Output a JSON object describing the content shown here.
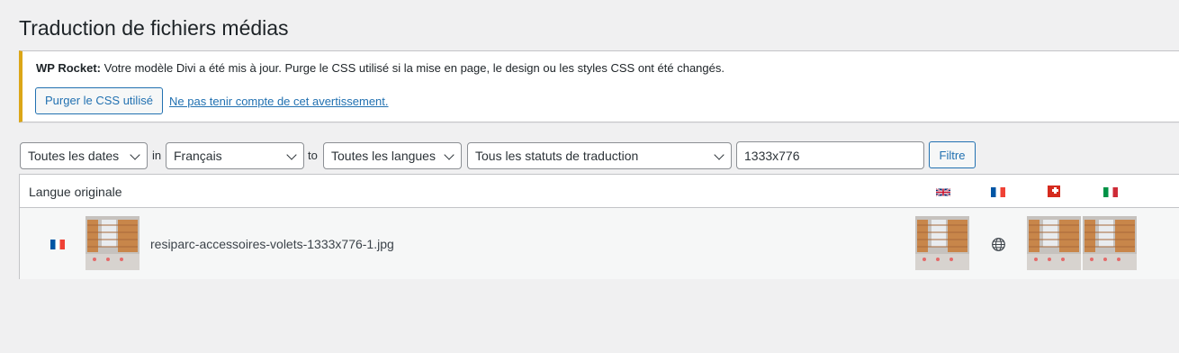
{
  "page": {
    "title": "Traduction de fichiers médias"
  },
  "notice": {
    "brand": "WP Rocket:",
    "message": " Votre modèle Divi a été mis à jour. Purge le CSS utilisé si la mise en page, le design ou les styles CSS ont été changés.",
    "purge_button": "Purger le CSS utilisé",
    "dismiss_link": "Ne pas tenir compte de cet avertissement.",
    "accent_color": "#dba617"
  },
  "filters": {
    "dates": "Toutes les dates",
    "in_word": "in",
    "source_language": "Français",
    "to_word": "to",
    "target_language": "Toutes les langues",
    "status": "Tous les statuts de traduction",
    "search_value": "1333x776",
    "filter_button": "Filtre"
  },
  "table": {
    "header_label": "Langue originale",
    "language_flags": [
      "flag-gb",
      "flag-fr",
      "flag-ch",
      "flag-it"
    ],
    "rows": [
      {
        "original_flag": "flag-fr",
        "filename": "resiparc-accessoires-volets-1333x776-1.jpg",
        "translations": [
          "thumbnail",
          "globe-icon",
          "thumbnail",
          "thumbnail"
        ]
      }
    ]
  },
  "colors": {
    "link": "#2271b1",
    "text": "#1d2327",
    "background": "#f0f0f1"
  }
}
